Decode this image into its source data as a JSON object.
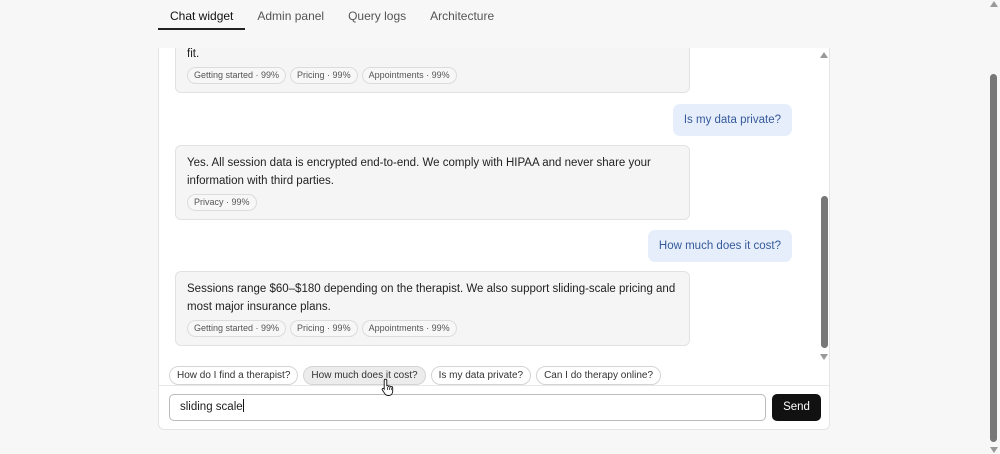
{
  "tabs": [
    {
      "label": "Chat widget",
      "active": true
    },
    {
      "label": "Admin panel",
      "active": false
    },
    {
      "label": "Query logs",
      "active": false
    },
    {
      "label": "Architecture",
      "active": false
    }
  ],
  "messages": {
    "bot_partial": {
      "text": "fit.",
      "chips": [
        "Getting started · 99%",
        "Pricing · 99%",
        "Appointments · 99%"
      ]
    },
    "user_1": "Is my data private?",
    "bot_1": {
      "text": "Yes. All session data is encrypted end-to-end. We comply with HIPAA and never share your information with third parties.",
      "chips": [
        "Privacy · 99%"
      ]
    },
    "user_2": "How much does it cost?",
    "bot_2": {
      "text": "Sessions range $60–$180 depending on the therapist. We also support sliding-scale pricing and most major insurance plans.",
      "chips": [
        "Getting started · 99%",
        "Pricing · 99%",
        "Appointments · 99%"
      ]
    }
  },
  "suggestions": [
    "How do I find a therapist?",
    "How much does it cost?",
    "Is my data private?",
    "Can I do therapy online?"
  ],
  "composer": {
    "value": "sliding scale",
    "send_label": "Send"
  },
  "icons": {
    "cursor": "hand-pointer-icon",
    "scroll_up": "triangle-up-icon",
    "scroll_down": "triangle-down-icon"
  }
}
